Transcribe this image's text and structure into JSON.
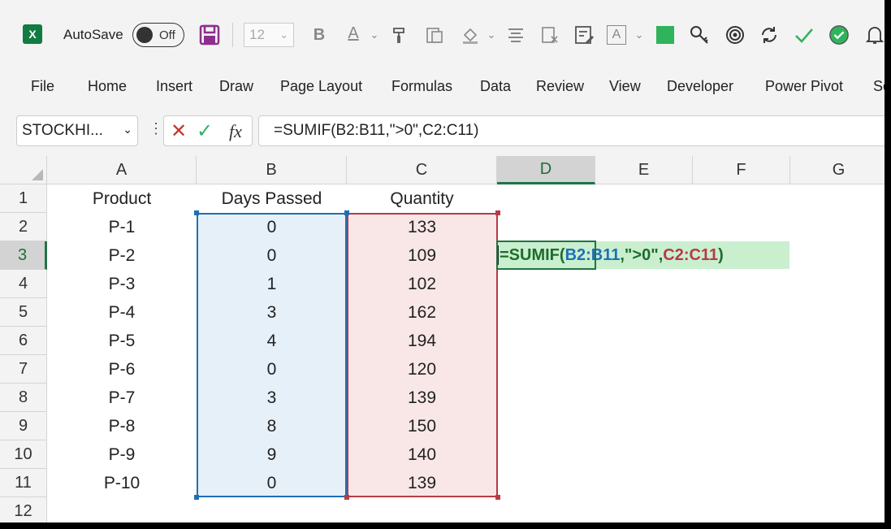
{
  "toolbar": {
    "autosave_label": "AutoSave",
    "autosave_state": "Off",
    "font_size": "12",
    "bold_label": "B",
    "font_color_label": "A",
    "text_box_label": "A"
  },
  "menu": [
    "File",
    "Home",
    "Insert",
    "Draw",
    "Page Layout",
    "Formulas",
    "Data",
    "Review",
    "View",
    "Developer",
    "Power Pivot",
    "Se"
  ],
  "formula_bar": {
    "name_box": "STOCKHI...",
    "fx_label": "fx",
    "formula": "=SUMIF(B2:B11,\">0\",C2:C11)"
  },
  "columns": [
    "A",
    "B",
    "C",
    "D",
    "E",
    "F",
    "G"
  ],
  "rows": [
    "1",
    "2",
    "3",
    "4",
    "5",
    "6",
    "7",
    "8",
    "9",
    "10",
    "11",
    "12"
  ],
  "headers": {
    "a": "Product",
    "b": "Days Passed",
    "c": "Quantity"
  },
  "data": [
    {
      "product": "P-1",
      "days": "0",
      "qty": "133"
    },
    {
      "product": "P-2",
      "days": "0",
      "qty": "109"
    },
    {
      "product": "P-3",
      "days": "1",
      "qty": "102"
    },
    {
      "product": "P-4",
      "days": "3",
      "qty": "162"
    },
    {
      "product": "P-5",
      "days": "4",
      "qty": "194"
    },
    {
      "product": "P-6",
      "days": "0",
      "qty": "120"
    },
    {
      "product": "P-7",
      "days": "3",
      "qty": "139"
    },
    {
      "product": "P-8",
      "days": "8",
      "qty": "150"
    },
    {
      "product": "P-9",
      "days": "9",
      "qty": "140"
    },
    {
      "product": "P-10",
      "days": "0",
      "qty": "139"
    }
  ],
  "editing_cell": {
    "prefix": "=SUMIF(",
    "range1": "B2:B11",
    "criteria": ",\">0\",",
    "range2": "C2:C11",
    "suffix": ")"
  },
  "colors": {
    "accent": "#217346",
    "range_b": "#1f6fb5",
    "range_c": "#b73a44",
    "edit_fill": "#c9efcf"
  }
}
